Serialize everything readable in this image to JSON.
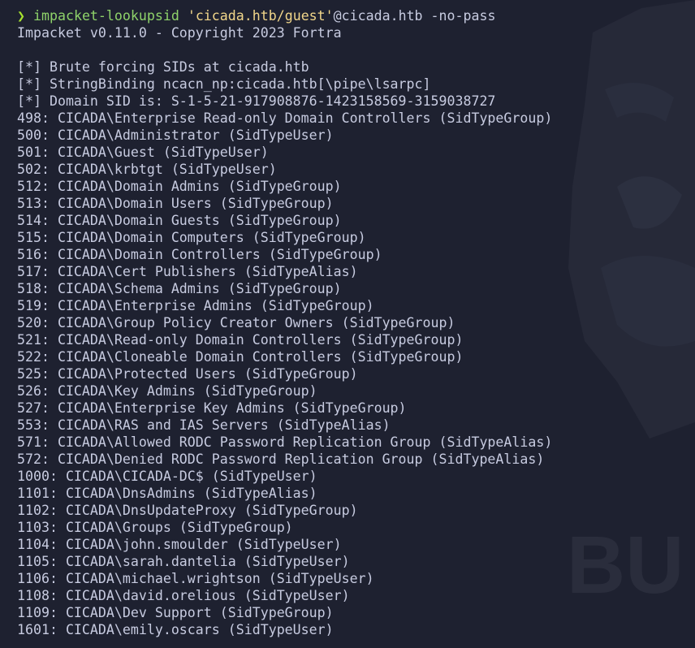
{
  "terminal": {
    "prompt_symbol": "❯",
    "command": {
      "program": "impacket-lookupsid",
      "target_string": "'cicada.htb/guest'",
      "rest": "@cicada.htb -no-pass"
    },
    "colors": {
      "background": "#1e2130",
      "text": "#c7cbe0",
      "prompt": "#a6e22e",
      "command": "#8fd36a",
      "string": "#f1d68a"
    },
    "watermark_text": "BU",
    "lines": [
      "Impacket v0.11.0 - Copyright 2023 Fortra",
      "",
      "[*] Brute forcing SIDs at cicada.htb",
      "[*] StringBinding ncacn_np:cicada.htb[\\pipe\\lsarpc]",
      "[*] Domain SID is: S-1-5-21-917908876-1423158569-3159038727",
      "498: CICADA\\Enterprise Read-only Domain Controllers (SidTypeGroup)",
      "500: CICADA\\Administrator (SidTypeUser)",
      "501: CICADA\\Guest (SidTypeUser)",
      "502: CICADA\\krbtgt (SidTypeUser)",
      "512: CICADA\\Domain Admins (SidTypeGroup)",
      "513: CICADA\\Domain Users (SidTypeGroup)",
      "514: CICADA\\Domain Guests (SidTypeGroup)",
      "515: CICADA\\Domain Computers (SidTypeGroup)",
      "516: CICADA\\Domain Controllers (SidTypeGroup)",
      "517: CICADA\\Cert Publishers (SidTypeAlias)",
      "518: CICADA\\Schema Admins (SidTypeGroup)",
      "519: CICADA\\Enterprise Admins (SidTypeGroup)",
      "520: CICADA\\Group Policy Creator Owners (SidTypeGroup)",
      "521: CICADA\\Read-only Domain Controllers (SidTypeGroup)",
      "522: CICADA\\Cloneable Domain Controllers (SidTypeGroup)",
      "525: CICADA\\Protected Users (SidTypeGroup)",
      "526: CICADA\\Key Admins (SidTypeGroup)",
      "527: CICADA\\Enterprise Key Admins (SidTypeGroup)",
      "553: CICADA\\RAS and IAS Servers (SidTypeAlias)",
      "571: CICADA\\Allowed RODC Password Replication Group (SidTypeAlias)",
      "572: CICADA\\Denied RODC Password Replication Group (SidTypeAlias)",
      "1000: CICADA\\CICADA-DC$ (SidTypeUser)",
      "1101: CICADA\\DnsAdmins (SidTypeAlias)",
      "1102: CICADA\\DnsUpdateProxy (SidTypeGroup)",
      "1103: CICADA\\Groups (SidTypeGroup)",
      "1104: CICADA\\john.smoulder (SidTypeUser)",
      "1105: CICADA\\sarah.dantelia (SidTypeUser)",
      "1106: CICADA\\michael.wrightson (SidTypeUser)",
      "1108: CICADA\\david.orelious (SidTypeUser)",
      "1109: CICADA\\Dev Support (SidTypeGroup)",
      "1601: CICADA\\emily.oscars (SidTypeUser)"
    ]
  }
}
